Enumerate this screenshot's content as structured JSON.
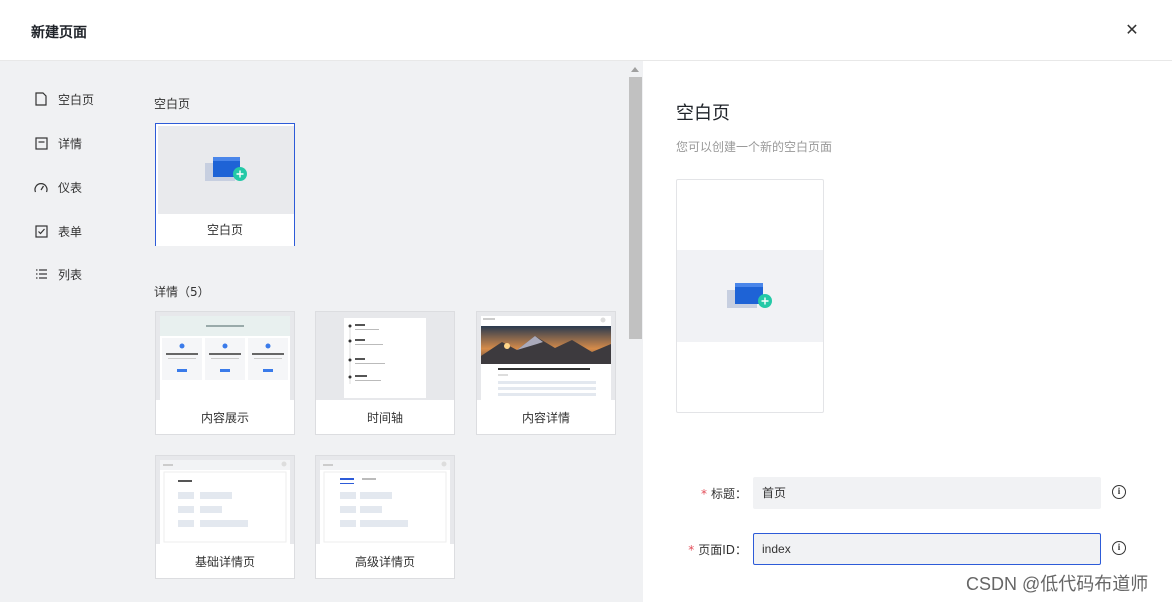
{
  "dialog": {
    "title": "新建页面",
    "close_icon": "close-icon"
  },
  "sidebar": {
    "items": [
      {
        "label": "空白页",
        "icon": "file-icon"
      },
      {
        "label": "详情",
        "icon": "detail-icon"
      },
      {
        "label": "仪表",
        "icon": "dashboard-icon"
      },
      {
        "label": "表单",
        "icon": "checkbox-icon"
      },
      {
        "label": "列表",
        "icon": "list-icon"
      }
    ]
  },
  "templates": {
    "blank_section": "空白页",
    "blank_cards": [
      {
        "label": "空白页"
      }
    ],
    "detail_section": "详情（5）",
    "detail_cards": [
      {
        "label": "内容展示"
      },
      {
        "label": "时间轴"
      },
      {
        "label": "内容详情"
      },
      {
        "label": "基础详情页"
      },
      {
        "label": "高级详情页"
      }
    ]
  },
  "preview": {
    "title": "空白页",
    "description": "您可以创建一个新的空白页面"
  },
  "form": {
    "title_label": "标题：",
    "title_value": "首页",
    "id_label": "页面ID：",
    "id_value": "index"
  },
  "colors": {
    "accent": "#2d5bd8",
    "required": "#e34d59",
    "panel_bg": "#f0f1f3"
  },
  "watermark": "CSDN @低代码布道师"
}
